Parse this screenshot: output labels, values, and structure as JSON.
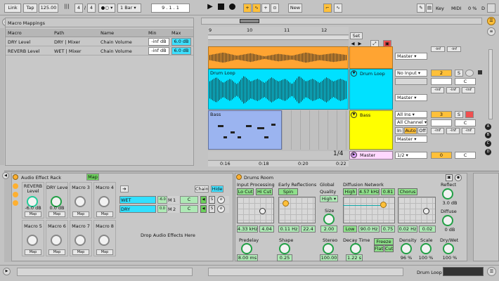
{
  "transport": {
    "link": "Link",
    "tap": "Tap",
    "tempo": "125.00",
    "sig_num": "4",
    "sig_den": "4",
    "quant": "1 Bar",
    "position": "9 .  1 .  1",
    "new_btn": "New",
    "key": "Key",
    "midi": "MIDI",
    "cpu": "0 %",
    "disk": "D"
  },
  "macro_panel": {
    "title": "Macro Mappings",
    "headers": [
      "Macro",
      "Path",
      "Name",
      "Min",
      "Max"
    ],
    "rows": [
      [
        "DRY Level",
        "DRY | Mixer",
        "Chain Volume",
        "-inf dB",
        "6.0 dB"
      ],
      [
        "REVERB Level",
        "WET | Mixer",
        "Chain Volume",
        "-inf dB",
        "6.0 dB"
      ]
    ]
  },
  "arrangement": {
    "bars": [
      "9",
      "10",
      "11",
      "12"
    ],
    "set_label": "Set",
    "page_counter": "1/4",
    "time_labels": [
      "0:16",
      "0:18",
      "0:20",
      "0:22"
    ]
  },
  "tracks": [
    {
      "name": "",
      "input": "",
      "output": "Master",
      "num": "",
      "color": "#ffa432"
    },
    {
      "name": "Drum Loop",
      "input": "No Input",
      "output": "Master",
      "num": "2",
      "pan": "C",
      "sends": [
        "-inf",
        "-inf",
        "-inf"
      ],
      "color": "#00e1ff"
    },
    {
      "name": "Bass",
      "input": "All Ins",
      "channel": "All Channel",
      "monitor": [
        "In",
        "Auto",
        "Off"
      ],
      "output": "Master",
      "num": "3",
      "pan": "C",
      "sends": [
        "-inf",
        "-inf",
        "-inf"
      ],
      "color": "#ffff00"
    },
    {
      "name": "Master",
      "input": "1/2",
      "num": "0",
      "pan": "C",
      "color": "#ffe0ff"
    }
  ],
  "clip_labels": {
    "drum": "Drum Loop",
    "bass": "Bass"
  },
  "scene_letters": [
    "A",
    "B",
    "C",
    "D"
  ],
  "rack": {
    "title": "Audio Effect Rack",
    "map": "Map",
    "macros": [
      {
        "name": "REVERB Level",
        "value": "-6.0 dB"
      },
      {
        "name": "DRY Level",
        "value": "0.0 dB"
      },
      {
        "name": "Macro 3",
        "value": ""
      },
      {
        "name": "Macro 4",
        "value": ""
      },
      {
        "name": "Macro 5",
        "value": ""
      },
      {
        "name": "Macro 6",
        "value": ""
      },
      {
        "name": "Macro 7",
        "value": ""
      },
      {
        "name": "Macro 8",
        "value": ""
      }
    ],
    "chains": [
      {
        "name": "WET",
        "vol": "-6.0",
        "m": "M",
        "num": "1",
        "pan": "C"
      },
      {
        "name": "DRY",
        "vol": "0.0",
        "m": "M",
        "num": "2",
        "pan": "C"
      }
    ],
    "chain_btn": "Chain",
    "hide_btn": "Hide",
    "drop": "Drop Audio Effects Here"
  },
  "reverb": {
    "title": "Drums Room",
    "input_proc": "Input Processing",
    "lo_cut": "Lo Cut",
    "hi_cut": "Hi Cut",
    "in_freq": "4.33 kHz",
    "in_q": "4.04",
    "early": "Early Reflections",
    "spin": "Spin",
    "er_freq": "0.11 Hz",
    "er_amt": "22.4",
    "global": "Global",
    "quality": "Quality",
    "quality_val": "High",
    "size": "Size",
    "size_val": "2.00",
    "diffusion": "Diffusion Network",
    "high": "High",
    "high_freq": "4.57 kHz",
    "high_val": "0.81",
    "chorus": "Chorus",
    "low": "Low",
    "low_freq": "90.0 Hz",
    "low_val": "0.75",
    "ch_rate": "0.02 Hz",
    "ch_amt": "0.02",
    "reflect": "Reflect",
    "reflect_val": "3.0 dB",
    "diffuse": "Diffuse",
    "diffuse_val": "0 dB",
    "predelay": "Predelay",
    "predelay_val": "8.00 ms",
    "shape": "Shape",
    "shape_val": "0.25",
    "stereo": "Stereo",
    "stereo_val": "100.00",
    "decay": "Decay Time",
    "decay_val": "1.22 s",
    "freeze": "Freeze",
    "flat": "Flat",
    "cut": "Cut",
    "density": "Density",
    "density_val": "96 %",
    "scale": "Scale",
    "scale_val": "100 %",
    "drywet": "Dry/Wet",
    "drywet_val": "100 %"
  },
  "status": {
    "track": "Drum Loop"
  }
}
